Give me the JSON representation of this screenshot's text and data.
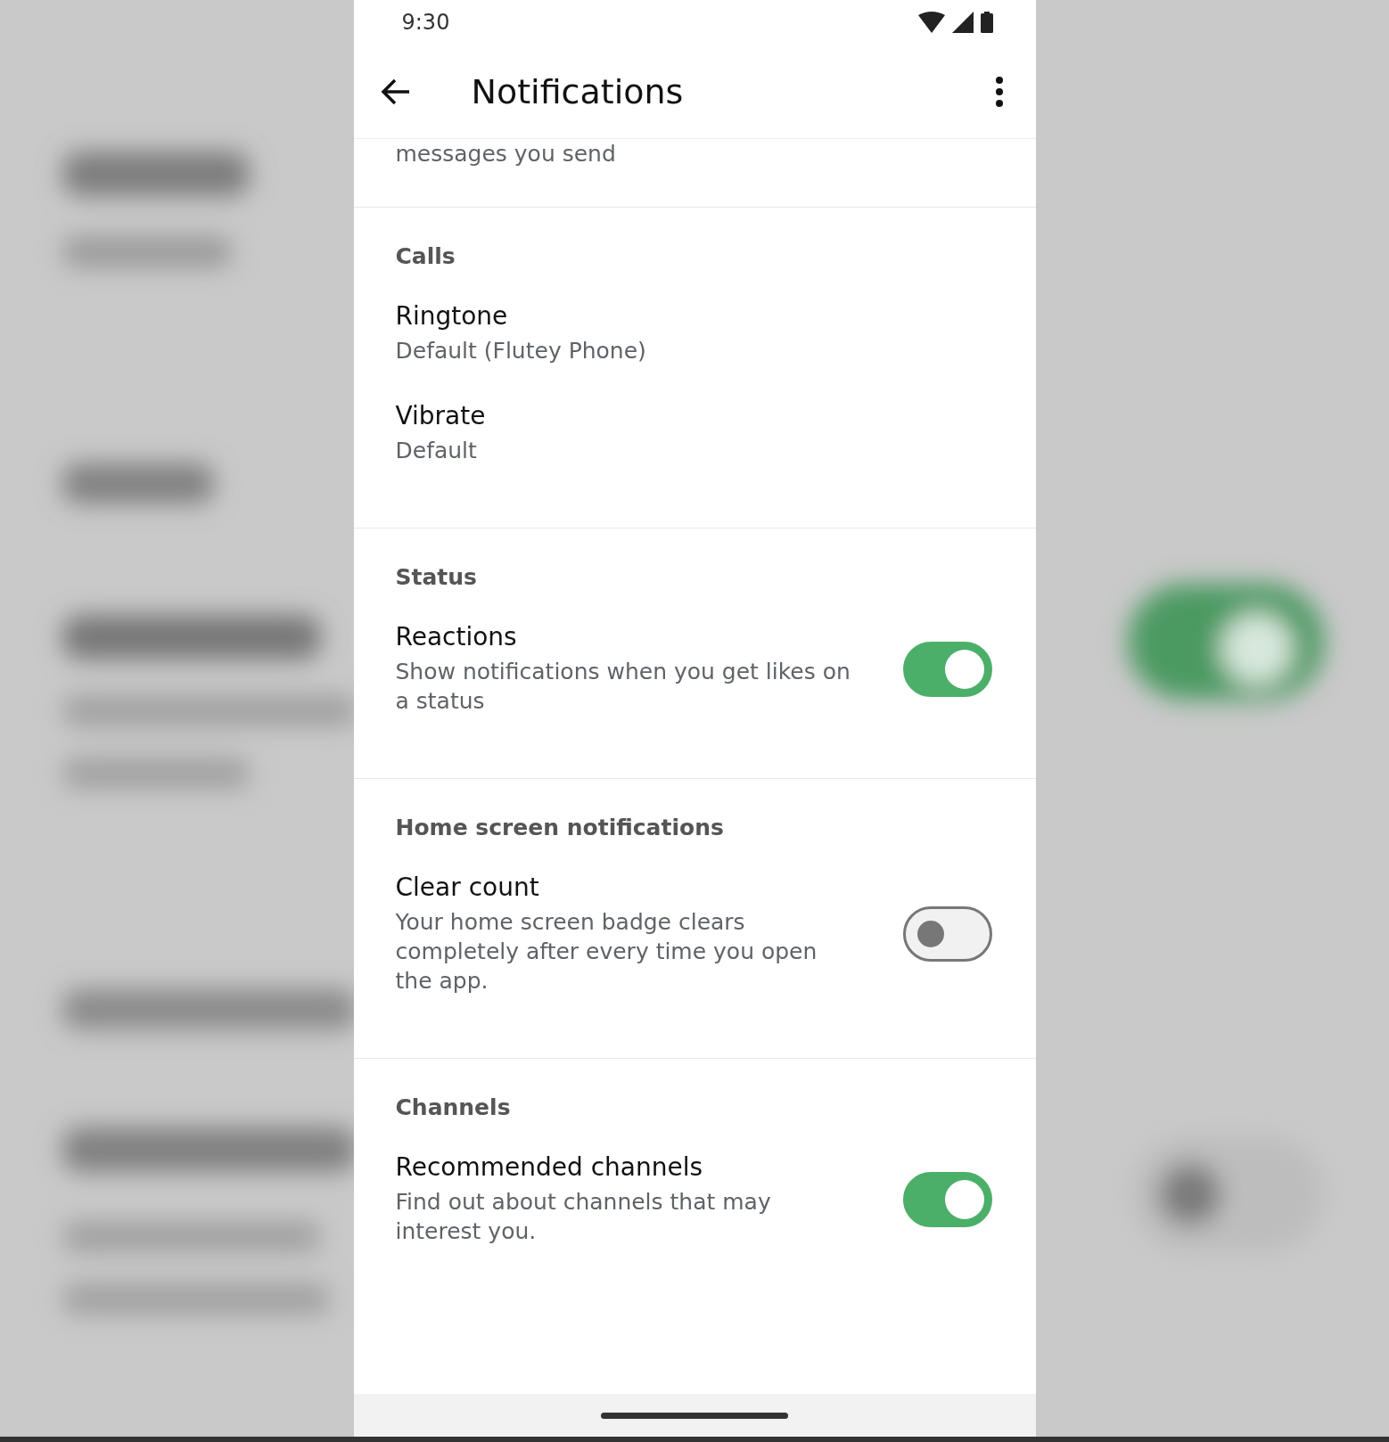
{
  "status_bar": {
    "time": "9:30"
  },
  "app_bar": {
    "title": "Notifications"
  },
  "partial_item": {
    "subtitle": "messages you send"
  },
  "sections": [
    {
      "header": "Calls",
      "items": [
        {
          "kind": "value",
          "title": "Ringtone",
          "subtitle": "Default (Flutey Phone)"
        },
        {
          "kind": "value",
          "title": "Vibrate",
          "subtitle": "Default"
        }
      ]
    },
    {
      "header": "Status",
      "items": [
        {
          "kind": "toggle",
          "title": "Reactions",
          "subtitle": "Show notifications when you get likes on a status",
          "on": true
        }
      ]
    },
    {
      "header": "Home screen notifications",
      "items": [
        {
          "kind": "toggle",
          "title": "Clear count",
          "subtitle": "Your home screen badge clears completely after every time you open the app.",
          "on": false
        }
      ]
    },
    {
      "header": "Channels",
      "items": [
        {
          "kind": "toggle",
          "title": "Recommended channels",
          "subtitle": "Find out about channels that may interest you.",
          "on": true
        }
      ]
    }
  ]
}
